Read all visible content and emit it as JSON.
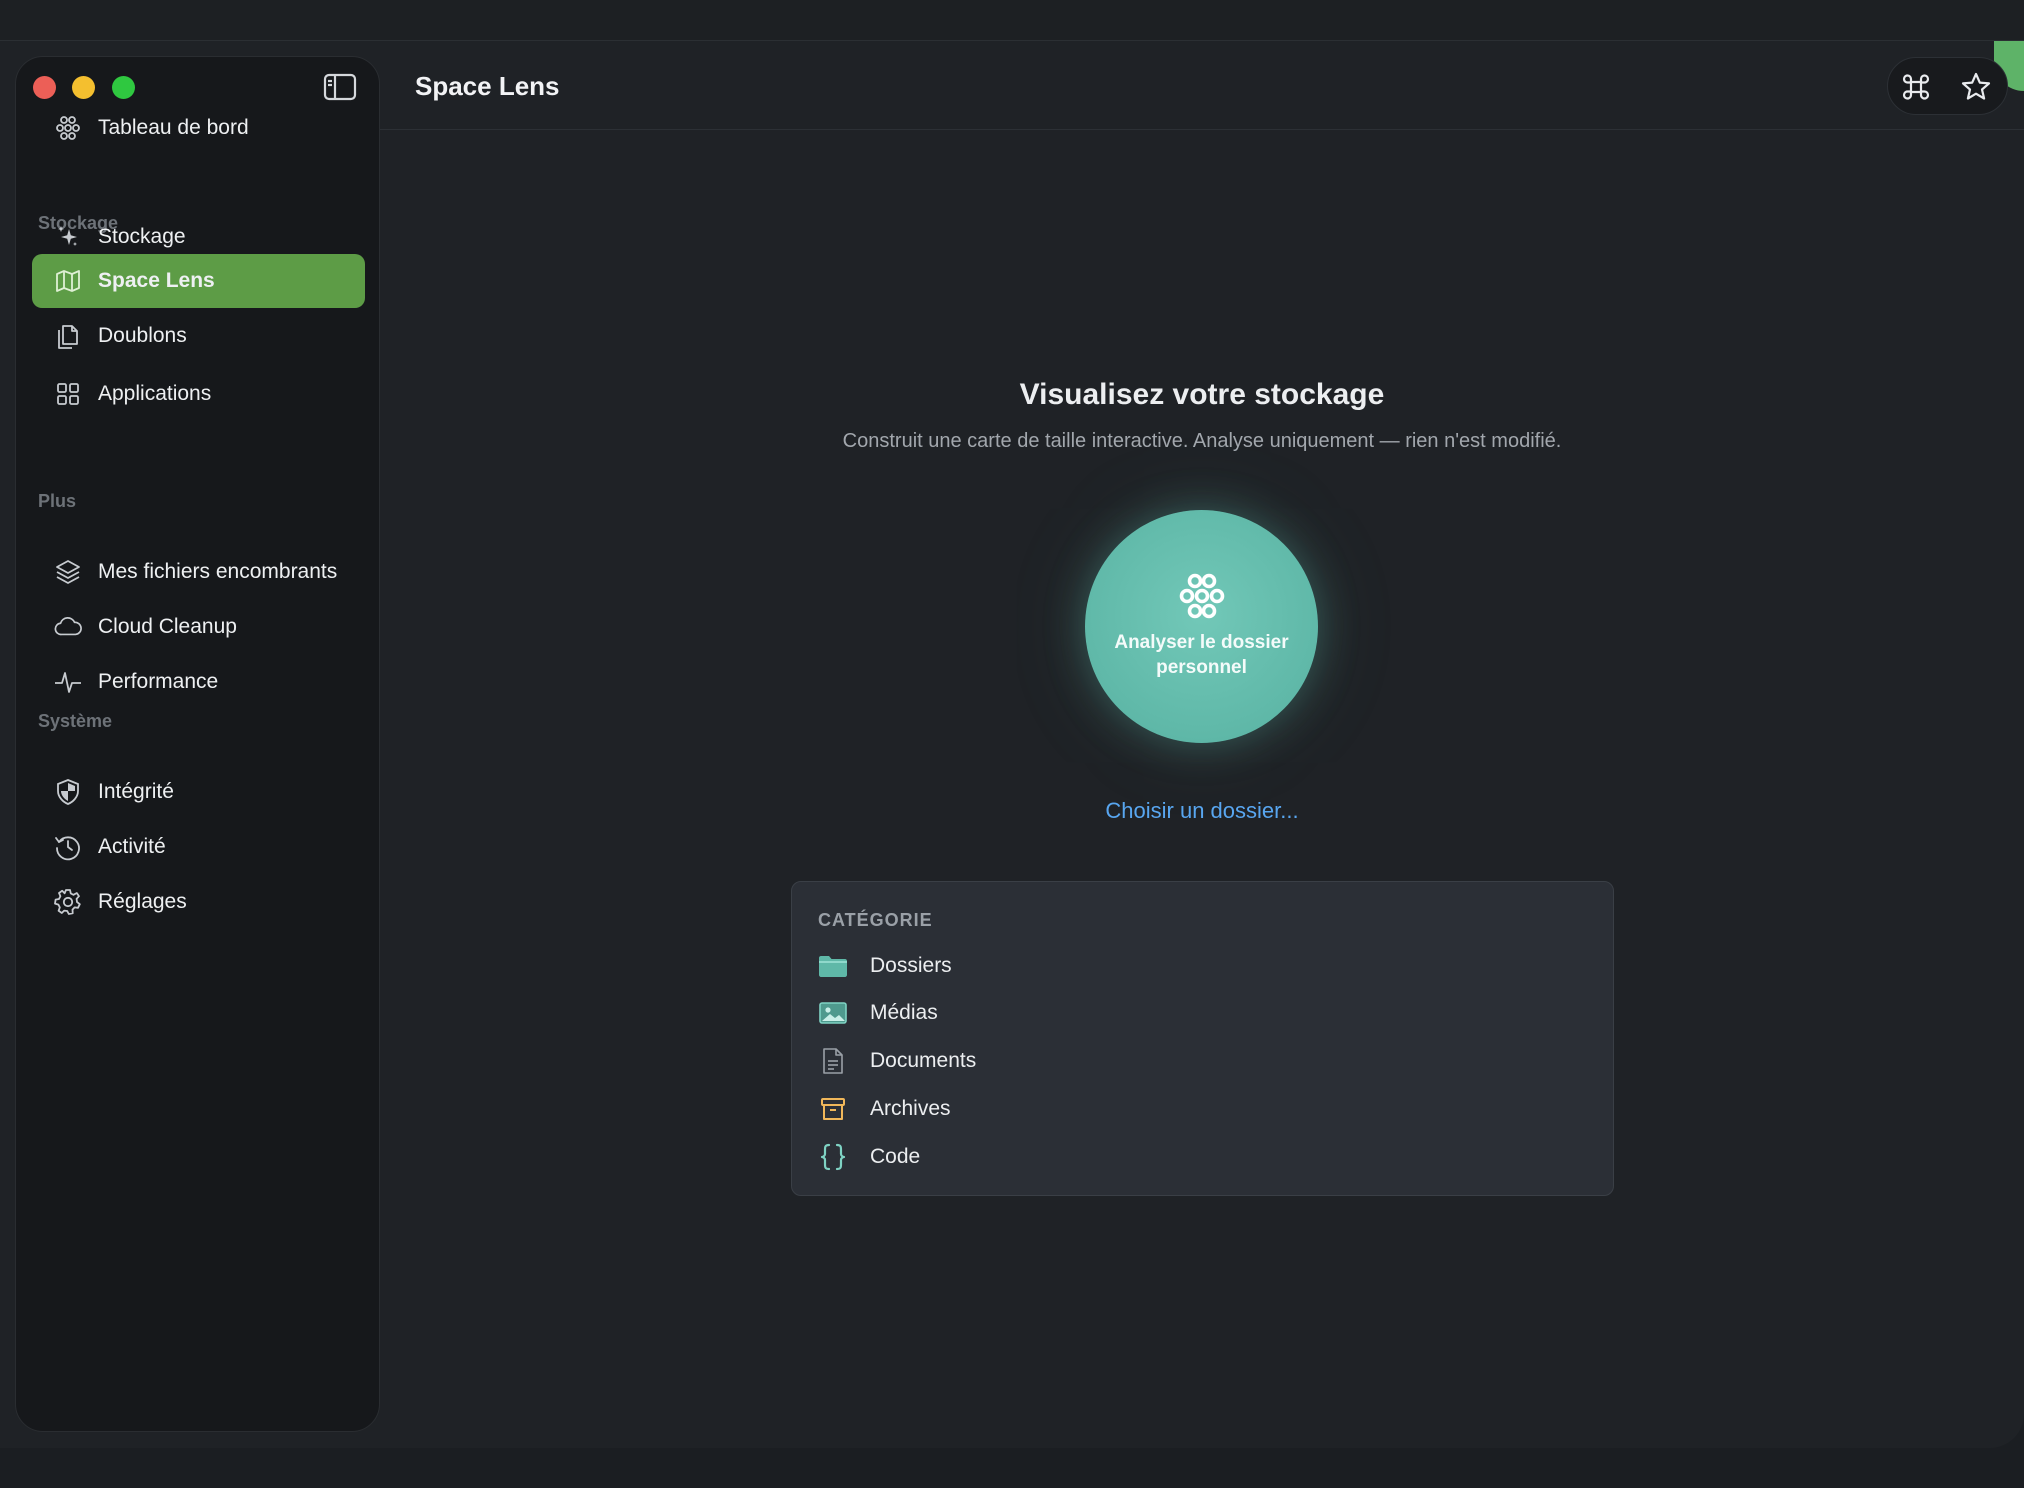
{
  "window": {
    "page_title": "Space Lens"
  },
  "sidebar": {
    "dashboard": {
      "label": "Tableau de bord",
      "icon": "flower-icon"
    },
    "sections": [
      {
        "label": "Stockage"
      },
      {
        "label": "Plus"
      },
      {
        "label": "Système"
      }
    ],
    "items": [
      {
        "label": "Stockage",
        "icon": "sparkle-icon"
      },
      {
        "label": "Space Lens",
        "icon": "map-icon",
        "active": true
      },
      {
        "label": "Doublons",
        "icon": "duplicate-files-icon"
      },
      {
        "label": "Applications",
        "icon": "grid-icon"
      },
      {
        "label": "Mes fichiers encombrants",
        "icon": "layers-icon"
      },
      {
        "label": "Cloud Cleanup",
        "icon": "cloud-icon"
      },
      {
        "label": "Performance",
        "icon": "pulse-icon"
      },
      {
        "label": "Intégrité",
        "icon": "shield-icon"
      },
      {
        "label": "Activité",
        "icon": "history-icon"
      },
      {
        "label": "Réglages",
        "icon": "gear-icon"
      }
    ]
  },
  "header_tools": [
    {
      "icon": "command-icon"
    },
    {
      "icon": "star-icon"
    }
  ],
  "main": {
    "title": "Visualisez votre stockage",
    "subtitle": "Construit une carte de taille interactive. Analyse uniquement — rien n'est modifié.",
    "scan_button": "Analyser le dossier personnel",
    "choose_link": "Choisir un dossier...",
    "category": {
      "heading": "CATÉGORIE",
      "items": [
        {
          "label": "Dossiers",
          "icon": "folder-icon",
          "color": "#5fb8a8"
        },
        {
          "label": "Médias",
          "icon": "image-icon",
          "color": "#5fb8a8"
        },
        {
          "label": "Documents",
          "icon": "document-icon",
          "color": "#9aa0a7"
        },
        {
          "label": "Archives",
          "icon": "archive-box-icon",
          "color": "#f0b75a"
        },
        {
          "label": "Code",
          "icon": "braces-icon",
          "color": "#7fd3c4"
        }
      ]
    }
  },
  "colors": {
    "accent_green": "#5d9c46",
    "teal": "#5fb8a8",
    "link_blue": "#58a6f0"
  }
}
